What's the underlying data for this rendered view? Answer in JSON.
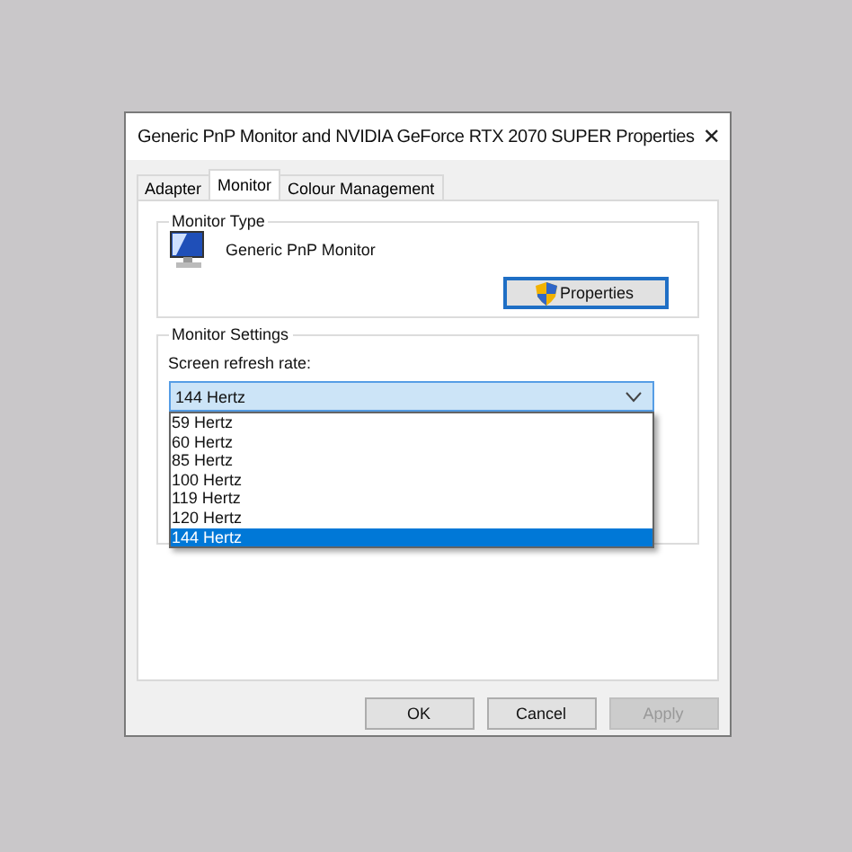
{
  "window": {
    "title": "Generic PnP Monitor and NVIDIA GeForce RTX 2070 SUPER Properties",
    "close": "✕"
  },
  "tabs": [
    {
      "label": "Adapter",
      "selected": false
    },
    {
      "label": "Monitor",
      "selected": true
    },
    {
      "label": "Colour Management",
      "selected": false
    }
  ],
  "monitor_type": {
    "title": "Monitor Type",
    "name": "Generic PnP Monitor",
    "button": "Properties"
  },
  "monitor_settings": {
    "title": "Monitor Settings",
    "label": "Screen refresh rate:",
    "value": "144 Hertz",
    "expanded": true,
    "options": [
      {
        "label": "59 Hertz",
        "selected": false
      },
      {
        "label": "60 Hertz",
        "selected": false
      },
      {
        "label": "85 Hertz",
        "selected": false
      },
      {
        "label": "100 Hertz",
        "selected": false
      },
      {
        "label": "119 Hertz",
        "selected": false
      },
      {
        "label": "120 Hertz",
        "selected": false
      },
      {
        "label": "144 Hertz",
        "selected": true
      }
    ]
  },
  "buttons": [
    {
      "label": "OK",
      "disabled": false
    },
    {
      "label": "Cancel",
      "disabled": false
    },
    {
      "label": "Apply",
      "disabled": true
    }
  ]
}
